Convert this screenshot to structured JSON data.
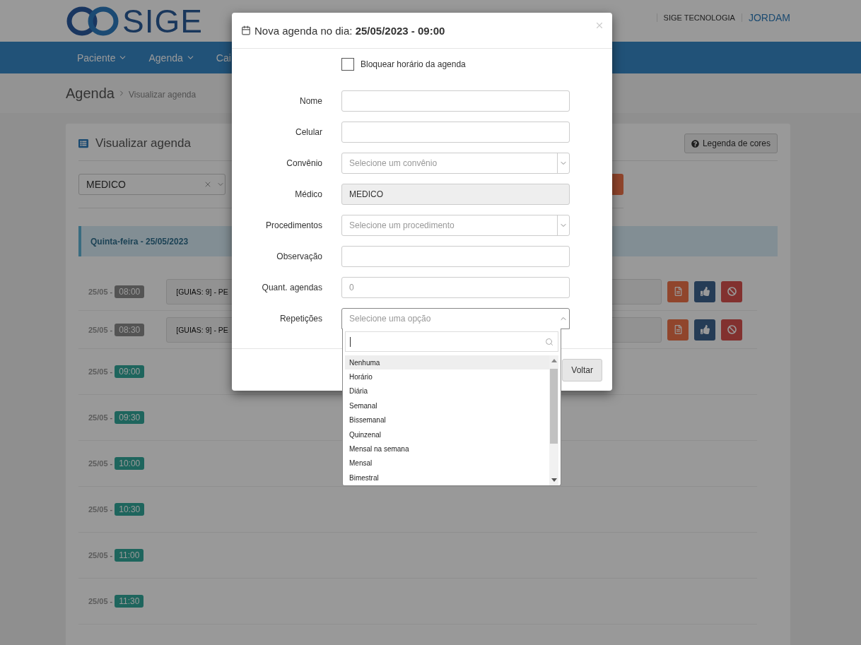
{
  "header": {
    "brand": "SIGE",
    "company": "SIGE TECNOLOGIA",
    "user": "JORDAM"
  },
  "nav": [
    {
      "label": "Paciente",
      "has_menu": true
    },
    {
      "label": "Agenda",
      "has_menu": true
    },
    {
      "label": "Cai",
      "has_menu": false
    }
  ],
  "breadcrumb": {
    "title": "Agenda",
    "current": "Visualizar agenda"
  },
  "card": {
    "title": "Visualizar agenda",
    "legend_button": "Legenda de cores",
    "doctor_select": "MEDICO",
    "day": "Quinta-feira - 25/05/2023",
    "slots": [
      {
        "date": "25/05 -",
        "time": "08:00",
        "booked": true,
        "entry": "[GUIAS: 9] - PE"
      },
      {
        "date": "25/05 -",
        "time": "08:30",
        "booked": true,
        "entry": "[GUIAS: 9] - PE"
      },
      {
        "date": "25/05 -",
        "time": "09:00",
        "booked": false
      },
      {
        "date": "25/05 -",
        "time": "09:30",
        "booked": false
      },
      {
        "date": "25/05 -",
        "time": "10:00",
        "booked": false
      },
      {
        "date": "25/05 -",
        "time": "10:30",
        "booked": false
      },
      {
        "date": "25/05 -",
        "time": "11:00",
        "booked": false
      },
      {
        "date": "25/05 -",
        "time": "11:30",
        "booked": false
      }
    ]
  },
  "modal": {
    "title": "Nova agenda no dia: **25/05/2023 - 09:00**",
    "block_checkbox": {
      "label": "Bloquear horário da agenda",
      "checked": false
    },
    "fields": [
      {
        "label": "Nome",
        "kind": "input"
      },
      {
        "label": "Celular",
        "kind": "input"
      },
      {
        "label": "Convênio",
        "kind": "select",
        "placeholder": "Selecione um convênio"
      },
      {
        "label": "Médico",
        "kind": "readonly",
        "value": "MEDICO"
      },
      {
        "label": "Procedimentos",
        "kind": "select",
        "placeholder": "Selecione um procedimento"
      },
      {
        "label": "Observação",
        "kind": "input"
      },
      {
        "label": "Quant. agendas",
        "kind": "input",
        "placeholder": "0"
      },
      {
        "label": "Repetições",
        "kind": "select",
        "placeholder": "Selecione uma opção",
        "expanded": true
      }
    ],
    "footer_button": "Voltar",
    "dropdown": {
      "options": [
        {
          "label": "Nenhuma",
          "selected": true
        },
        {
          "label": "Horário",
          "selected": false
        },
        {
          "label": "Diária",
          "selected": false
        },
        {
          "label": "Semanal",
          "selected": false
        },
        {
          "label": "Bissemanal",
          "selected": false
        },
        {
          "label": "Quinzenal",
          "selected": false
        },
        {
          "label": "Mensal na semana",
          "selected": false
        },
        {
          "label": "Mensal",
          "selected": false
        },
        {
          "label": "Bimestral",
          "selected": false
        }
      ]
    }
  }
}
